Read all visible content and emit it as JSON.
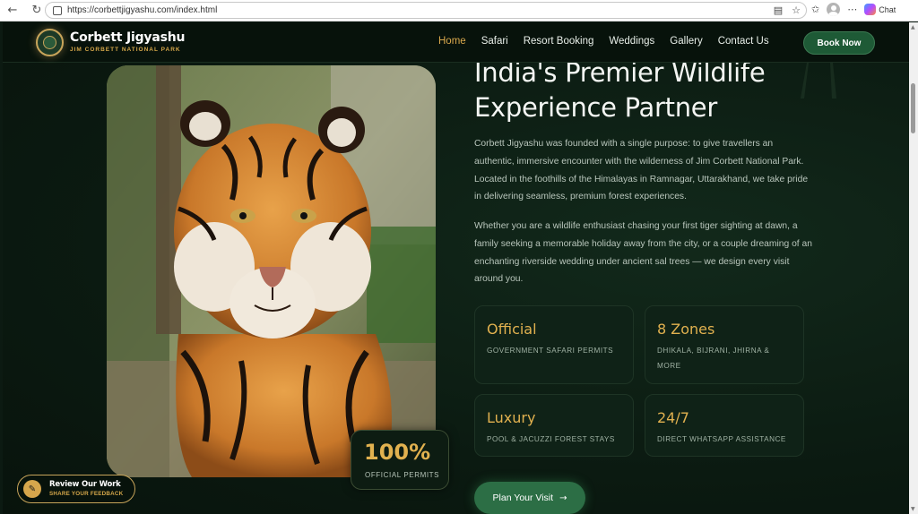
{
  "browser": {
    "url": "https://corbettjigyashu.com/index.html",
    "back_icon": "arrow-left-icon",
    "reload_icon": "reload-icon",
    "chat_label": "Chat"
  },
  "header": {
    "brand_name": "Corbett Jigyashu",
    "brand_sub": "JIM CORBETT NATIONAL PARK",
    "nav": [
      {
        "label": "Home",
        "active": true
      },
      {
        "label": "Safari"
      },
      {
        "label": "Resort Booking"
      },
      {
        "label": "Weddings"
      },
      {
        "label": "Gallery"
      },
      {
        "label": "Contact Us"
      }
    ],
    "cta": "Book Now"
  },
  "hero": {
    "stat_value": "100%",
    "stat_label": "OFFICIAL PERMITS"
  },
  "about": {
    "headline": "India's Premier Wildlife Experience Partner",
    "para1": "Corbett Jigyashu was founded with a single purpose: to give travellers an authentic, immersive encounter with the wilderness of Jim Corbett National Park. Located in the foothills of the Himalayas in Ramnagar, Uttarakhand, we take pride in delivering seamless, premium forest experiences.",
    "para2": "Whether you are a wildlife enthusiast chasing your first tiger sighting at dawn, a family seeking a memorable holiday away from the city, or a couple dreaming of an enchanting riverside wedding under ancient sal trees — we design every visit around you.",
    "features": [
      {
        "title": "Official",
        "desc": "GOVERNMENT SAFARI PERMITS"
      },
      {
        "title": "8 Zones",
        "desc": "DHIKALA, BIJRANI, JHIRNA & MORE"
      },
      {
        "title": "Luxury",
        "desc": "POOL & JACUZZI FOREST STAYS"
      },
      {
        "title": "24/7",
        "desc": "DIRECT WHATSAPP ASSISTANCE"
      }
    ],
    "cta": "Plan Your Visit"
  },
  "review": {
    "title": "Review Our Work",
    "sub": "SHARE YOUR FEEDBACK"
  },
  "colors": {
    "accent_gold": "#e1b14f",
    "brand_green": "#2c6e45",
    "bg_dark": "#0d1f15"
  }
}
